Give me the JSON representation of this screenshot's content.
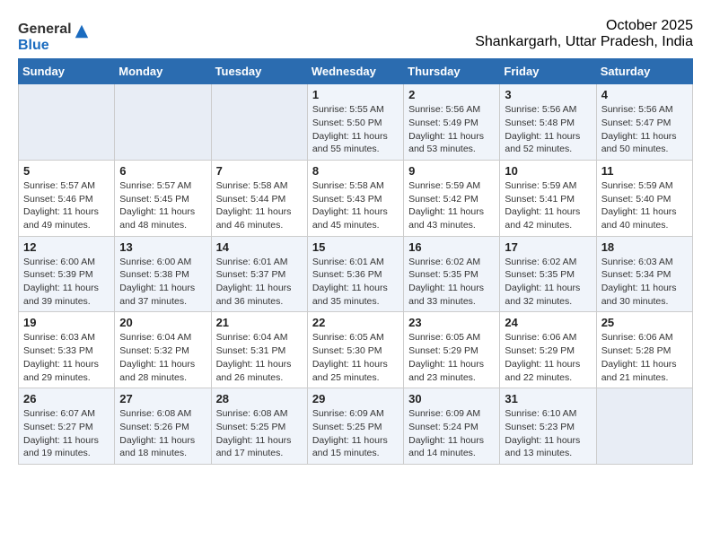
{
  "header": {
    "logo_general": "General",
    "logo_blue": "Blue",
    "month_year": "October 2025",
    "location": "Shankargarh, Uttar Pradesh, India"
  },
  "weekdays": [
    "Sunday",
    "Monday",
    "Tuesday",
    "Wednesday",
    "Thursday",
    "Friday",
    "Saturday"
  ],
  "weeks": [
    [
      {
        "day": "",
        "info": ""
      },
      {
        "day": "",
        "info": ""
      },
      {
        "day": "",
        "info": ""
      },
      {
        "day": "1",
        "info": "Sunrise: 5:55 AM\nSunset: 5:50 PM\nDaylight: 11 hours\nand 55 minutes."
      },
      {
        "day": "2",
        "info": "Sunrise: 5:56 AM\nSunset: 5:49 PM\nDaylight: 11 hours\nand 53 minutes."
      },
      {
        "day": "3",
        "info": "Sunrise: 5:56 AM\nSunset: 5:48 PM\nDaylight: 11 hours\nand 52 minutes."
      },
      {
        "day": "4",
        "info": "Sunrise: 5:56 AM\nSunset: 5:47 PM\nDaylight: 11 hours\nand 50 minutes."
      }
    ],
    [
      {
        "day": "5",
        "info": "Sunrise: 5:57 AM\nSunset: 5:46 PM\nDaylight: 11 hours\nand 49 minutes."
      },
      {
        "day": "6",
        "info": "Sunrise: 5:57 AM\nSunset: 5:45 PM\nDaylight: 11 hours\nand 48 minutes."
      },
      {
        "day": "7",
        "info": "Sunrise: 5:58 AM\nSunset: 5:44 PM\nDaylight: 11 hours\nand 46 minutes."
      },
      {
        "day": "8",
        "info": "Sunrise: 5:58 AM\nSunset: 5:43 PM\nDaylight: 11 hours\nand 45 minutes."
      },
      {
        "day": "9",
        "info": "Sunrise: 5:59 AM\nSunset: 5:42 PM\nDaylight: 11 hours\nand 43 minutes."
      },
      {
        "day": "10",
        "info": "Sunrise: 5:59 AM\nSunset: 5:41 PM\nDaylight: 11 hours\nand 42 minutes."
      },
      {
        "day": "11",
        "info": "Sunrise: 5:59 AM\nSunset: 5:40 PM\nDaylight: 11 hours\nand 40 minutes."
      }
    ],
    [
      {
        "day": "12",
        "info": "Sunrise: 6:00 AM\nSunset: 5:39 PM\nDaylight: 11 hours\nand 39 minutes."
      },
      {
        "day": "13",
        "info": "Sunrise: 6:00 AM\nSunset: 5:38 PM\nDaylight: 11 hours\nand 37 minutes."
      },
      {
        "day": "14",
        "info": "Sunrise: 6:01 AM\nSunset: 5:37 PM\nDaylight: 11 hours\nand 36 minutes."
      },
      {
        "day": "15",
        "info": "Sunrise: 6:01 AM\nSunset: 5:36 PM\nDaylight: 11 hours\nand 35 minutes."
      },
      {
        "day": "16",
        "info": "Sunrise: 6:02 AM\nSunset: 5:35 PM\nDaylight: 11 hours\nand 33 minutes."
      },
      {
        "day": "17",
        "info": "Sunrise: 6:02 AM\nSunset: 5:35 PM\nDaylight: 11 hours\nand 32 minutes."
      },
      {
        "day": "18",
        "info": "Sunrise: 6:03 AM\nSunset: 5:34 PM\nDaylight: 11 hours\nand 30 minutes."
      }
    ],
    [
      {
        "day": "19",
        "info": "Sunrise: 6:03 AM\nSunset: 5:33 PM\nDaylight: 11 hours\nand 29 minutes."
      },
      {
        "day": "20",
        "info": "Sunrise: 6:04 AM\nSunset: 5:32 PM\nDaylight: 11 hours\nand 28 minutes."
      },
      {
        "day": "21",
        "info": "Sunrise: 6:04 AM\nSunset: 5:31 PM\nDaylight: 11 hours\nand 26 minutes."
      },
      {
        "day": "22",
        "info": "Sunrise: 6:05 AM\nSunset: 5:30 PM\nDaylight: 11 hours\nand 25 minutes."
      },
      {
        "day": "23",
        "info": "Sunrise: 6:05 AM\nSunset: 5:29 PM\nDaylight: 11 hours\nand 23 minutes."
      },
      {
        "day": "24",
        "info": "Sunrise: 6:06 AM\nSunset: 5:29 PM\nDaylight: 11 hours\nand 22 minutes."
      },
      {
        "day": "25",
        "info": "Sunrise: 6:06 AM\nSunset: 5:28 PM\nDaylight: 11 hours\nand 21 minutes."
      }
    ],
    [
      {
        "day": "26",
        "info": "Sunrise: 6:07 AM\nSunset: 5:27 PM\nDaylight: 11 hours\nand 19 minutes."
      },
      {
        "day": "27",
        "info": "Sunrise: 6:08 AM\nSunset: 5:26 PM\nDaylight: 11 hours\nand 18 minutes."
      },
      {
        "day": "28",
        "info": "Sunrise: 6:08 AM\nSunset: 5:25 PM\nDaylight: 11 hours\nand 17 minutes."
      },
      {
        "day": "29",
        "info": "Sunrise: 6:09 AM\nSunset: 5:25 PM\nDaylight: 11 hours\nand 15 minutes."
      },
      {
        "day": "30",
        "info": "Sunrise: 6:09 AM\nSunset: 5:24 PM\nDaylight: 11 hours\nand 14 minutes."
      },
      {
        "day": "31",
        "info": "Sunrise: 6:10 AM\nSunset: 5:23 PM\nDaylight: 11 hours\nand 13 minutes."
      },
      {
        "day": "",
        "info": ""
      }
    ]
  ]
}
